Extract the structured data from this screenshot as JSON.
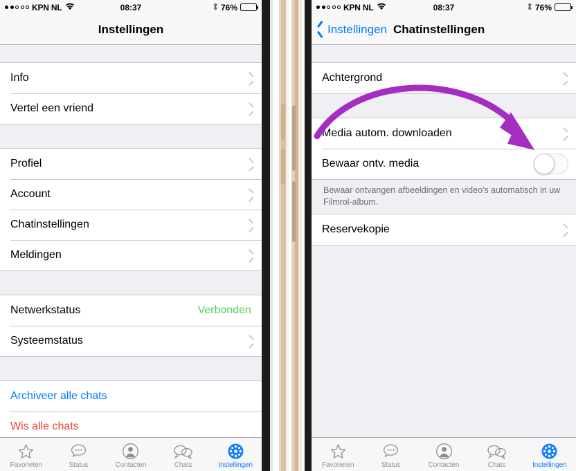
{
  "theme": {
    "accent_blue": "#007aff",
    "tab_active_blue": "#147efb",
    "status_green": "#4cd255",
    "danger_red": "#e8453c",
    "arrow_purple": "#a32ec0",
    "group_bg": "#ffffff",
    "page_bg": "#efeff4",
    "separator": "#c8c7cc",
    "bezel_gold": "#d8c2a6"
  },
  "statusbar": {
    "signal_dots_total": 5,
    "signal_dots_filled": 2,
    "carrier": "KPN NL",
    "wifi_icon": "wifi-icon",
    "time": "08:37",
    "bluetooth_icon": "bluetooth-icon",
    "battery_percent": "76%",
    "battery_level": 76
  },
  "left_phone": {
    "navbar": {
      "title": "Instellingen"
    },
    "sections": [
      {
        "rows": [
          {
            "label": "Info",
            "accessory": "chevron"
          },
          {
            "label": "Vertel een vriend",
            "accessory": "chevron"
          }
        ]
      },
      {
        "rows": [
          {
            "label": "Profiel",
            "accessory": "chevron"
          },
          {
            "label": "Account",
            "accessory": "chevron"
          },
          {
            "label": "Chatinstellingen",
            "accessory": "chevron"
          },
          {
            "label": "Meldingen",
            "accessory": "chevron"
          }
        ]
      },
      {
        "rows": [
          {
            "label": "Netwerkstatus",
            "accessory": "value",
            "value": "Verbonden"
          },
          {
            "label": "Systeemstatus",
            "accessory": "chevron"
          }
        ]
      },
      {
        "rows": [
          {
            "label": "Archiveer alle chats",
            "accessory": "none",
            "style": "link"
          },
          {
            "label": "Wis alle chats",
            "accessory": "none",
            "style": "danger"
          }
        ]
      }
    ]
  },
  "right_phone": {
    "navbar": {
      "back_icon": "chevron-left-icon",
      "back_label": "Instellingen",
      "title": "Chatinstellingen"
    },
    "sections": [
      {
        "rows": [
          {
            "label": "Achtergrond",
            "accessory": "chevron"
          }
        ]
      },
      {
        "rows": [
          {
            "label": "Media autom. downloaden",
            "accessory": "chevron"
          },
          {
            "label": "Bewaar ontv. media",
            "accessory": "switch",
            "switch_on": false
          }
        ],
        "footnote": "Bewaar ontvangen afbeeldingen en video's automatisch in uw Filmrol-album."
      },
      {
        "rows": [
          {
            "label": "Reservekopie",
            "accessory": "chevron"
          }
        ]
      }
    ],
    "annotation": {
      "type": "curved-arrow",
      "points_to": "Bewaar ontv. media switch",
      "color": "#a32ec0"
    }
  },
  "tabbar": {
    "items": [
      {
        "label": "Favorieten",
        "icon": "star-icon",
        "active": false
      },
      {
        "label": "Status",
        "icon": "status-bubble-icon",
        "active": false
      },
      {
        "label": "Contacten",
        "icon": "contact-icon",
        "active": false
      },
      {
        "label": "Chats",
        "icon": "chats-icon",
        "active": false
      },
      {
        "label": "Instellingen",
        "icon": "gear-icon",
        "active": true
      }
    ]
  }
}
